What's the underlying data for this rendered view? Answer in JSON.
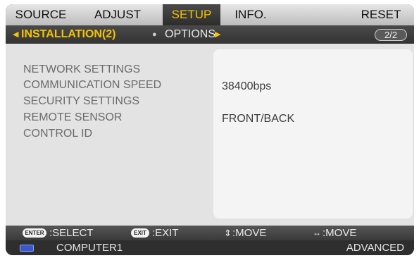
{
  "tabs": [
    {
      "label": "SOURCE"
    },
    {
      "label": "ADJUST"
    },
    {
      "label": "SETUP",
      "active": true
    },
    {
      "label": "INFO."
    },
    {
      "label": "RESET"
    }
  ],
  "subtabs": {
    "active_label": "INSTALLATION(2)",
    "inactive_label": "OPTIONS",
    "page": "2/2"
  },
  "menu_items": [
    {
      "label": "NETWORK SETTINGS",
      "value": ""
    },
    {
      "label": "COMMUNICATION SPEED",
      "value": "38400bps"
    },
    {
      "label": "SECURITY SETTINGS",
      "value": ""
    },
    {
      "label": "REMOTE SENSOR",
      "value": "FRONT/BACK"
    },
    {
      "label": "CONTROL ID",
      "value": ""
    }
  ],
  "hints": {
    "enter_key": "ENTER",
    "select": ":SELECT",
    "exit_key": "EXIT",
    "exit": ":EXIT",
    "updown_icon": "up-down-arrow-icon",
    "move_vertical": ":MOVE",
    "leftright_icon": "left-right-arrow-icon",
    "move_horizontal": ":MOVE"
  },
  "status": {
    "source_icon": "computer-input-icon",
    "source": "COMPUTER1",
    "mode": "ADVANCED"
  },
  "colors": {
    "accent": "#f6c300",
    "frame": "#3a3a3a",
    "content_bg": "#e3e3e3"
  }
}
